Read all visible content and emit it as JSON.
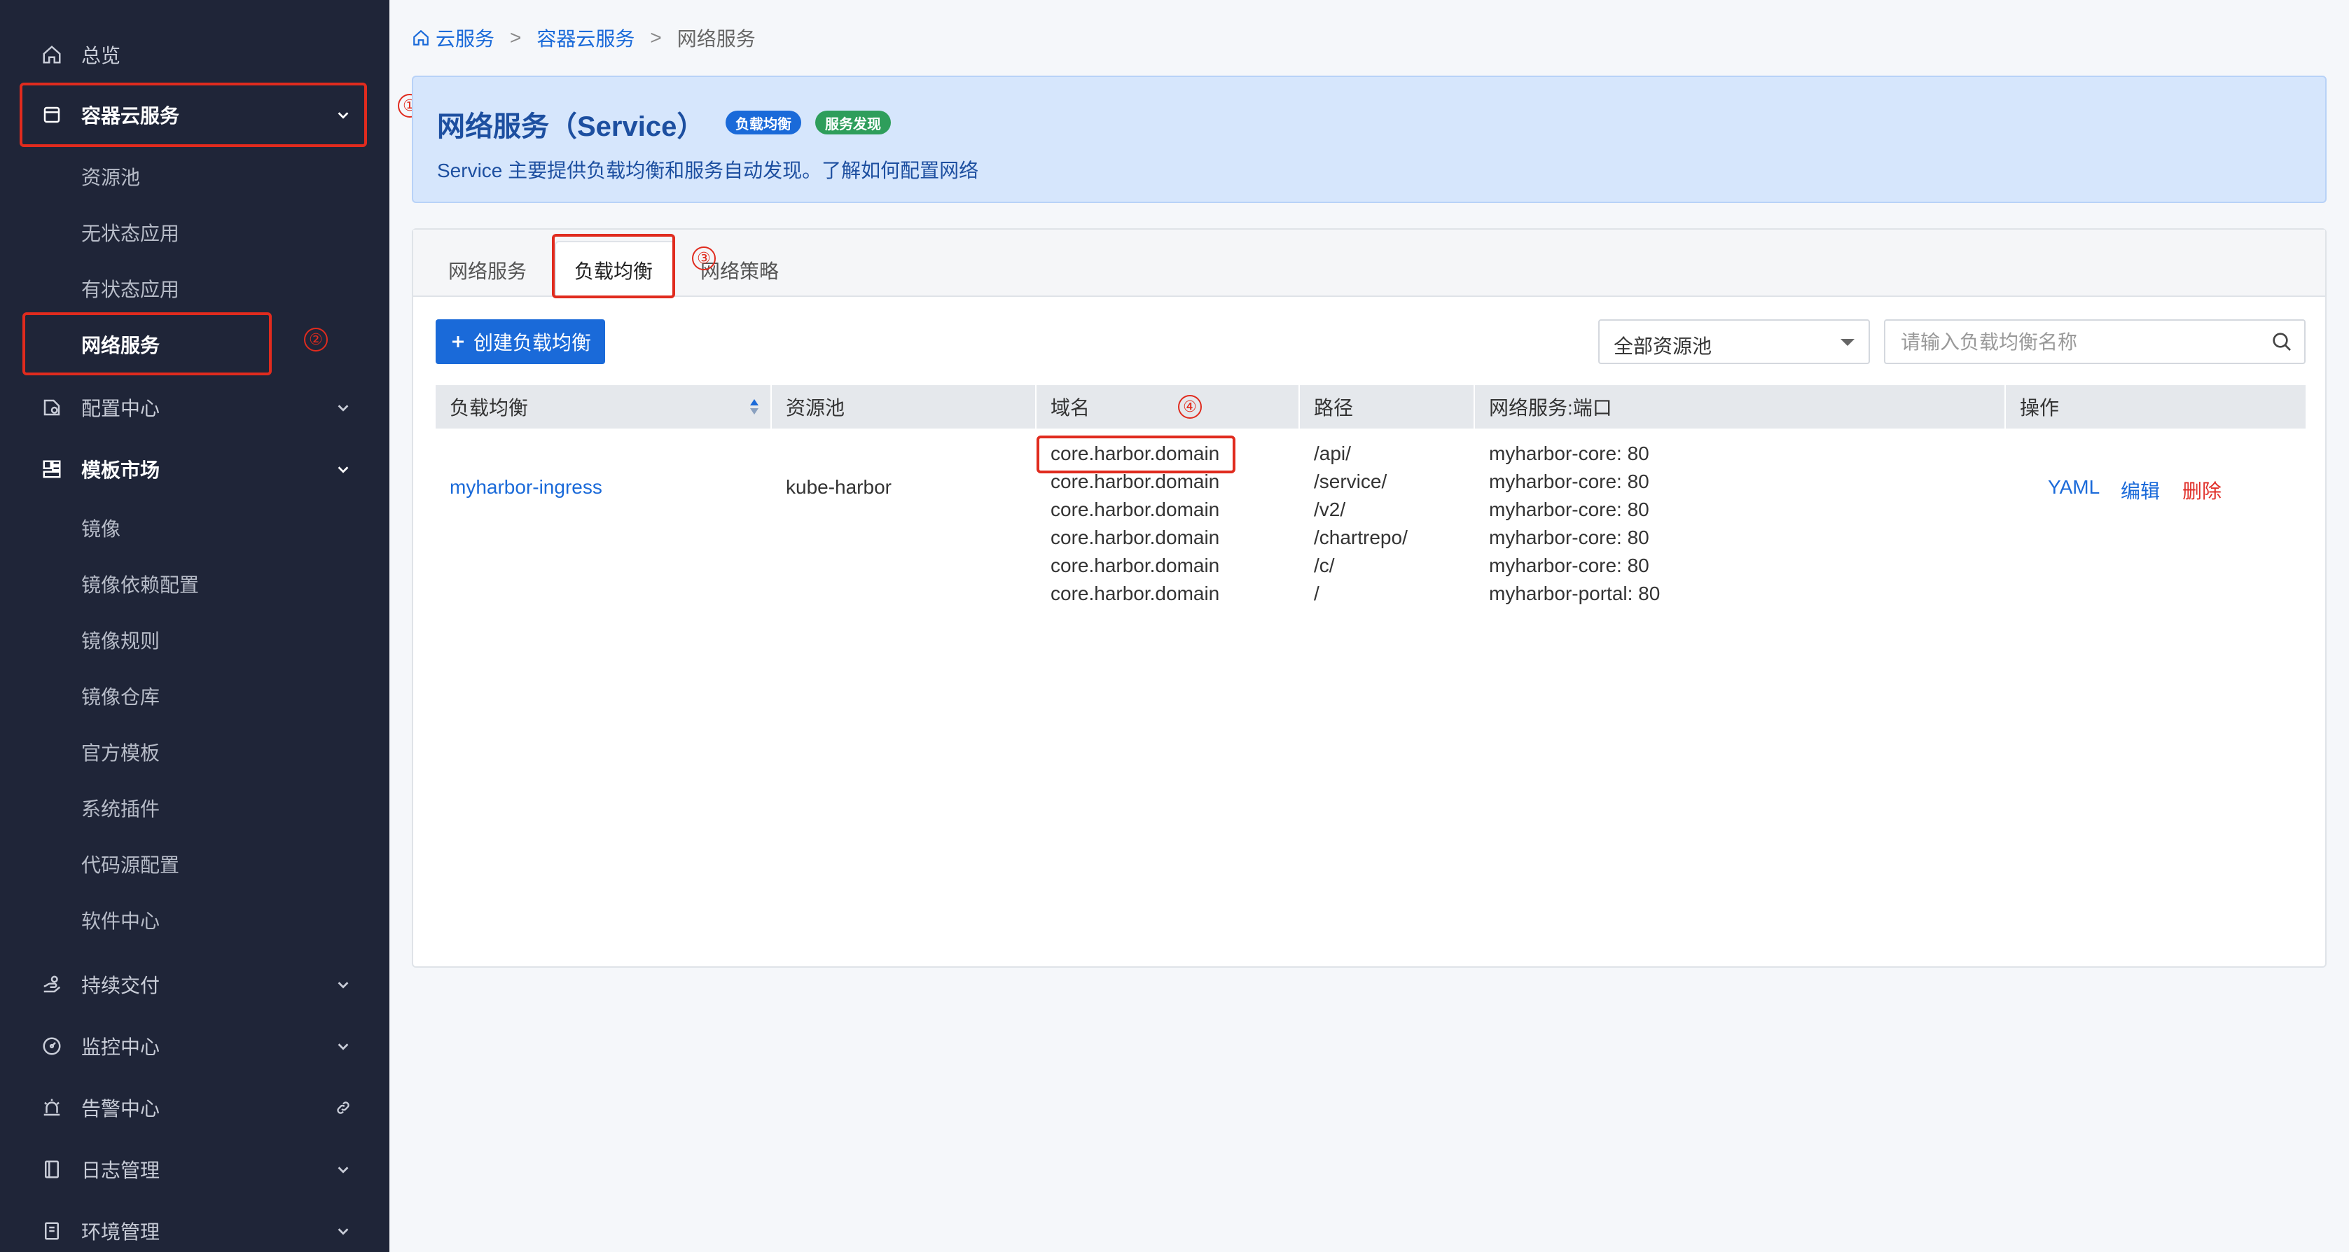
{
  "sidebar": {
    "items": [
      {
        "label": "总览",
        "icon": "home-icon",
        "arrow": ""
      },
      {
        "label": "容器云服务",
        "icon": "container-icon",
        "arrow": "chevron-down-icon"
      },
      {
        "label": "配置中心",
        "icon": "config-icon",
        "arrow": "chevron-down-icon"
      },
      {
        "label": "模板市场",
        "icon": "template-icon",
        "arrow": "chevron-down-icon"
      },
      {
        "label": "持续交付",
        "icon": "delivery-icon",
        "arrow": "chevron-down-icon"
      },
      {
        "label": "监控中心",
        "icon": "monitor-icon",
        "arrow": "chevron-down-icon"
      },
      {
        "label": "告警中心",
        "icon": "alarm-icon",
        "arrow": "link-icon"
      },
      {
        "label": "日志管理",
        "icon": "log-icon",
        "arrow": "chevron-down-icon"
      },
      {
        "label": "环境管理",
        "icon": "env-icon",
        "arrow": "chevron-down-icon"
      }
    ],
    "container_sub": [
      "资源池",
      "无状态应用",
      "有状态应用",
      "网络服务"
    ],
    "template_sub": [
      "镜像",
      "镜像依赖配置",
      "镜像规则",
      "镜像仓库",
      "官方模板",
      "系统插件",
      "代码源配置",
      "软件中心"
    ]
  },
  "markers": [
    "①",
    "②",
    "③",
    "④"
  ],
  "breadcrumb": {
    "items": [
      "云服务",
      "容器云服务",
      "网络服务"
    ],
    "separator": ">"
  },
  "banner": {
    "title": "网络服务（Service）",
    "badges": [
      {
        "label": "负载均衡",
        "color": "#1a6ad9"
      },
      {
        "label": "服务发现",
        "color": "#2e9e5b"
      }
    ],
    "description": "Service 主要提供负载均衡和服务自动发现。了解如何配置网络"
  },
  "tabs": [
    "网络服务",
    "负载均衡",
    "网络策略"
  ],
  "active_tab": "负载均衡",
  "toolbar": {
    "create_label": "创建负载均衡",
    "pool_select": "全部资源池",
    "search_placeholder": "请输入负载均衡名称"
  },
  "table": {
    "columns": [
      "负载均衡",
      "资源池",
      "域名",
      "路径",
      "网络服务:端口",
      "操作"
    ],
    "rows": [
      {
        "name": "myharbor-ingress",
        "pool": "kube-harbor",
        "domains": [
          "core.harbor.domain",
          "core.harbor.domain",
          "core.harbor.domain",
          "core.harbor.domain",
          "core.harbor.domain",
          "core.harbor.domain"
        ],
        "paths": [
          "/api/",
          "/service/",
          "/v2/",
          "/chartrepo/",
          "/c/",
          "/"
        ],
        "services": [
          "myharbor-core: 80",
          "myharbor-core: 80",
          "myharbor-core: 80",
          "myharbor-core: 80",
          "myharbor-core: 80",
          "myharbor-portal: 80"
        ],
        "actions": [
          "YAML",
          "编辑",
          "删除"
        ]
      }
    ]
  },
  "colors": {
    "sidebar_bg": "#1f2538",
    "accent": "#1a6ad9",
    "danger": "#e0302a",
    "highlight": "#e02b1e"
  }
}
